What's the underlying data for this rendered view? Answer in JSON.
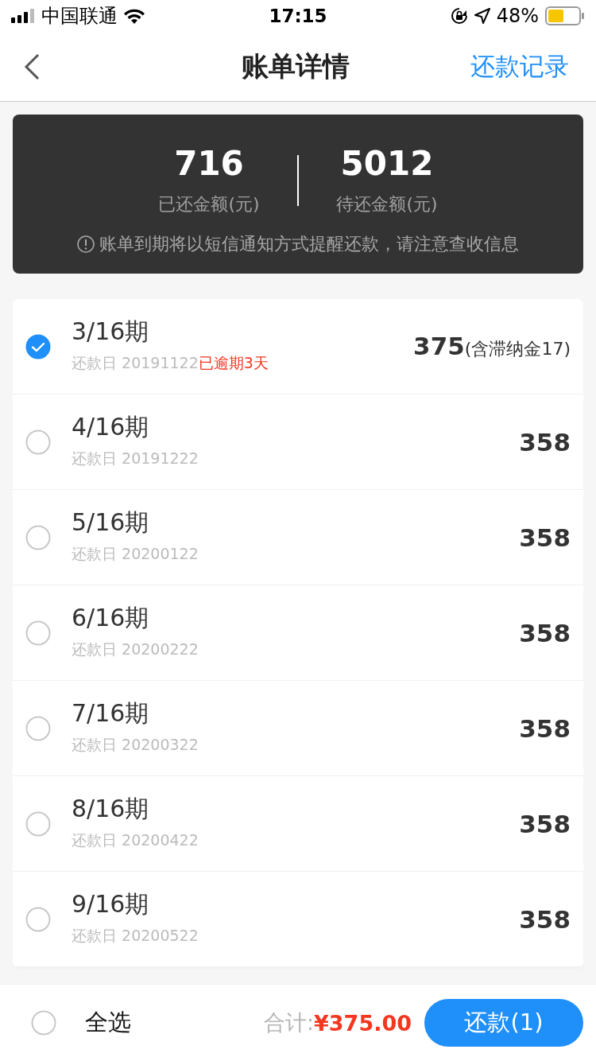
{
  "status_bar": {
    "carrier": "中国联通",
    "time": "17:15",
    "battery": "48%"
  },
  "nav": {
    "title": "账单详情",
    "action": "还款记录"
  },
  "summary": {
    "paid": {
      "amount": "716",
      "label": "已还金额(元)"
    },
    "pending": {
      "amount": "5012",
      "label": "待还金额(元)"
    },
    "notice": "账单到期将以短信通知方式提醒还款，请注意查收信息"
  },
  "bills": [
    {
      "period": "3/16期",
      "due": "还款日 20191122",
      "overdue": "已逾期3天",
      "amount": "375",
      "note": "(含滞纳金17)",
      "selected": true
    },
    {
      "period": "4/16期",
      "due": "还款日 20191222",
      "amount": "358",
      "selected": false
    },
    {
      "period": "5/16期",
      "due": "还款日 20200122",
      "amount": "358",
      "selected": false
    },
    {
      "period": "6/16期",
      "due": "还款日 20200222",
      "amount": "358",
      "selected": false
    },
    {
      "period": "7/16期",
      "due": "还款日 20200322",
      "amount": "358",
      "selected": false
    },
    {
      "period": "8/16期",
      "due": "还款日 20200422",
      "amount": "358",
      "selected": false
    },
    {
      "period": "9/16期",
      "due": "还款日 20200522",
      "amount": "358",
      "selected": false
    }
  ],
  "footer": {
    "select_all": {
      "label": "全选",
      "selected": false
    },
    "total_label": "合计:",
    "total": "¥375.00",
    "pay_button": "还款(1)"
  }
}
